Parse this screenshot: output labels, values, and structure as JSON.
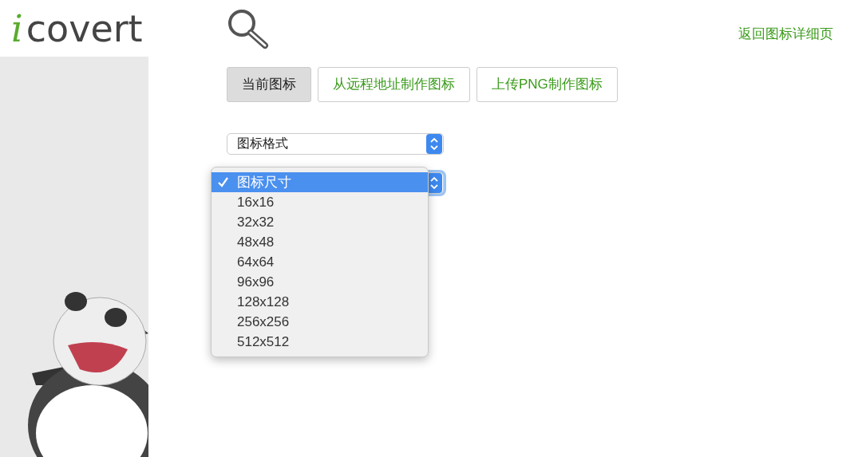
{
  "logo": {
    "letter": "i",
    "text": "covert"
  },
  "back_link": "返回图标详细页",
  "tabs": [
    {
      "label": "当前图标",
      "selected": true
    },
    {
      "label": "从远程地址制作图标",
      "selected": false
    },
    {
      "label": "上传PNG制作图标",
      "selected": false
    }
  ],
  "format_select": {
    "value": "图标格式"
  },
  "size_select": {
    "expanded": true,
    "options": [
      {
        "label": "图标尺寸",
        "selected": true
      },
      {
        "label": "16x16",
        "selected": false
      },
      {
        "label": "32x32",
        "selected": false
      },
      {
        "label": "48x48",
        "selected": false
      },
      {
        "label": "64x64",
        "selected": false
      },
      {
        "label": "96x96",
        "selected": false
      },
      {
        "label": "128x128",
        "selected": false
      },
      {
        "label": "256x256",
        "selected": false
      },
      {
        "label": "512x512",
        "selected": false
      }
    ]
  }
}
